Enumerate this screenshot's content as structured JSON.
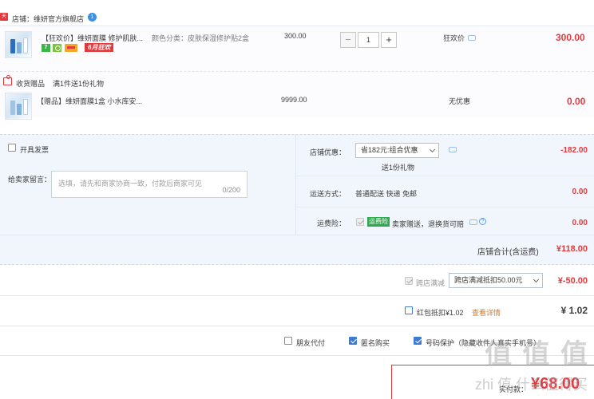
{
  "shop": {
    "badge": "天猫",
    "name": "店铺：维妍官方旗舰店",
    "ww_icon": "1"
  },
  "items": [
    {
      "title": "【狂欢价】维妍面膜 修护肌肤...",
      "sku": "颜色分类：皮肤保湿修护贴2盒",
      "unit_price": "300.00",
      "qty": "1",
      "promo": "狂欢价",
      "total": "300.00",
      "tags": {
        "seven": "7",
        "sale": "6月狂欢"
      }
    },
    {
      "title": "【赠品】维妍面膜1盒 小水库安...",
      "unit_price": "9999.00",
      "promo": "无优惠",
      "total": "0.00"
    }
  ],
  "gift": {
    "label": "收货赠品",
    "note": "满1件送1份礼物"
  },
  "options": {
    "invoice_label": "开具发票",
    "message_label": "给卖家留言：",
    "message_placeholder": "选填，请先和商家协商一致，付款后商家可见",
    "message_count": "0/200",
    "shop_discount_label": "店铺优惠：",
    "shop_discount_value": "省182元:组合优惠",
    "shop_discount_gift": "送1份礼物",
    "shop_discount_amount": "-182.00",
    "shipping_label": "运送方式：",
    "shipping_value": "普通配送 快递 免邮",
    "shipping_amount": "0.00",
    "insurance_label": "运费险：",
    "insurance_badge": "运费险",
    "insurance_value": "卖家赠送，退换货可赔",
    "insurance_amount": "0.00"
  },
  "subtotal": {
    "label": "店铺合计(含运费)",
    "value": "¥118.00"
  },
  "cross_store": {
    "label": "跨店满减",
    "select": "跨店满减抵扣50.00元",
    "amount": "¥-50.00"
  },
  "red_packet": {
    "label": "红包抵扣¥1.02",
    "link": "查看详情",
    "amount": "¥ 1.02"
  },
  "payment_options": {
    "friend_pay": "朋友代付",
    "anonymous": "匿名购买",
    "number_protect": "号码保护（隐藏收件人真实手机号）"
  },
  "total": {
    "label": "实付款：",
    "value": "¥68.00"
  },
  "watermark": {
    "logo": "值 值 值",
    "site": "zhi 值 什么值得买"
  },
  "colors": {
    "accent_red": "#e4393c",
    "panel_blue": "#f1f6fc",
    "check_blue": "#3d7bd6"
  }
}
